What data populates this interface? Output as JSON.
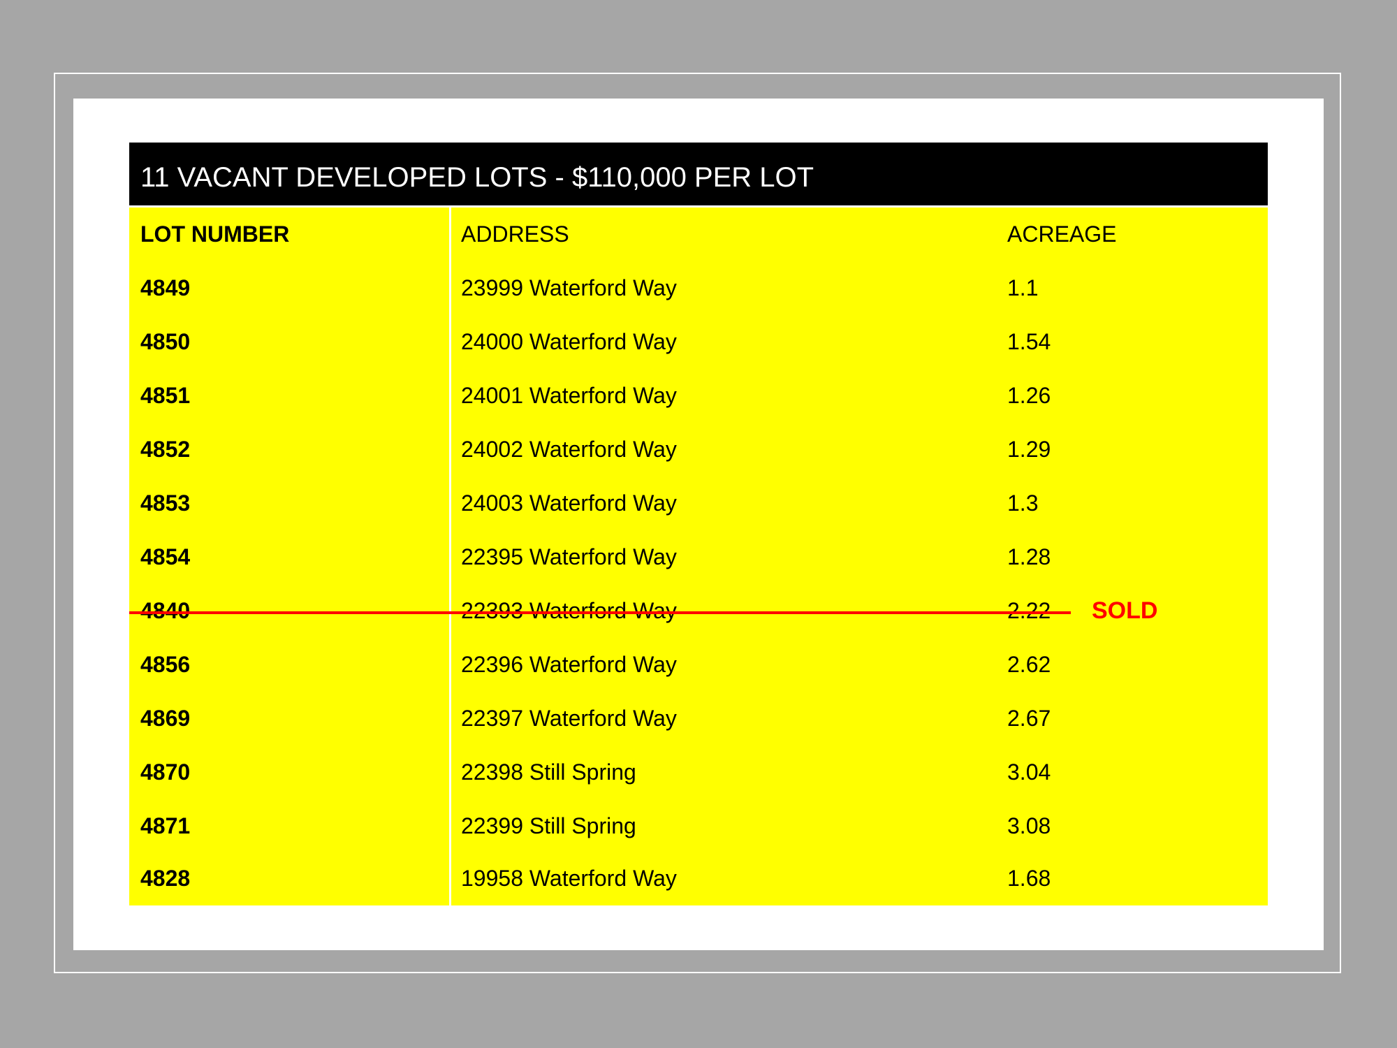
{
  "title": "11 VACANT DEVELOPED LOTS - $110,000 PER LOT",
  "columns": {
    "lot": "LOT NUMBER",
    "address": "ADDRESS",
    "acreage": "ACREAGE"
  },
  "rows": [
    {
      "lot": "4849",
      "address": "23999 Waterford Way",
      "acreage": "1.1"
    },
    {
      "lot": "4850",
      "address": "24000 Waterford Way",
      "acreage": "1.54"
    },
    {
      "lot": "4851",
      "address": "24001 Waterford Way",
      "acreage": "1.26"
    },
    {
      "lot": "4852",
      "address": "24002 Waterford Way",
      "acreage": "1.29"
    },
    {
      "lot": "4853",
      "address": "24003 Waterford Way",
      "acreage": "1.3"
    },
    {
      "lot": "4854",
      "address": "22395 Waterford Way",
      "acreage": "1.28"
    },
    {
      "lot": "4840",
      "address": "22393 Waterford Way",
      "acreage": "2.22",
      "status": "SOLD"
    },
    {
      "lot": "4856",
      "address": "22396 Waterford Way",
      "acreage": "2.62"
    },
    {
      "lot": "4869",
      "address": "22397 Waterford Way",
      "acreage": "2.67"
    },
    {
      "lot": "4870",
      "address": "22398 Still Spring",
      "acreage": "3.04"
    },
    {
      "lot": "4871",
      "address": "22399 Still Spring",
      "acreage": "3.08"
    },
    {
      "lot": "4828",
      "address": "19958 Waterford Way",
      "acreage": "1.68"
    }
  ],
  "colors": {
    "title_bg": "#000000",
    "table_bg": "#ffff00",
    "sold": "#ff0000",
    "frame": "#a6a6a6"
  }
}
